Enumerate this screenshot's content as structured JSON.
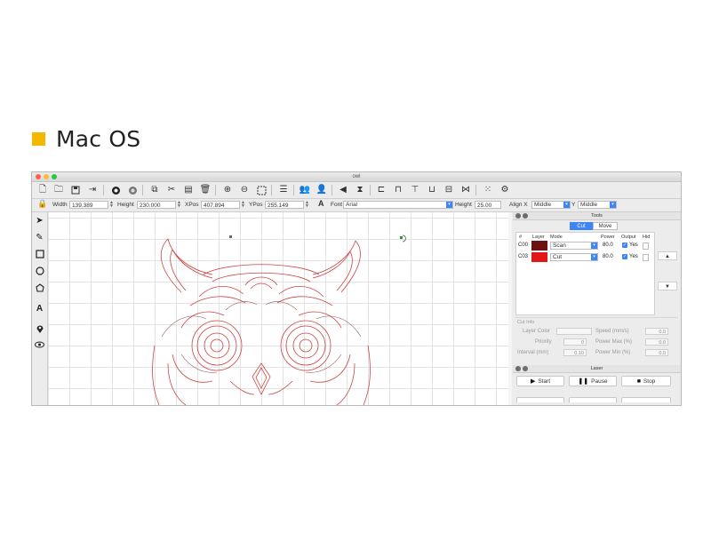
{
  "heading": {
    "title": "Mac OS",
    "bullet_color": "#f5b800"
  },
  "window": {
    "title": "owl",
    "traffic_lights": [
      "#ff5f57",
      "#febc2e",
      "#28c840"
    ],
    "toolbar_icons": [
      "new-file-icon",
      "open-folder-icon",
      "save-icon",
      "export-icon",
      "circle-filled-icon",
      "circle-gray-icon",
      "copy-icon",
      "cut-icon",
      "paste-icon",
      "delete-icon",
      "zoom-in-icon",
      "zoom-out-icon",
      "select-frame-icon",
      "list-icon",
      "group-icon",
      "user-icon",
      "flip-horizontal-icon",
      "mirror-icon",
      "align-left-icon",
      "align-top-icon",
      "align-center-icon",
      "align-bottom-icon",
      "distribute-icon",
      "link-icon",
      "grid-icon",
      "gear-icon"
    ],
    "properties": {
      "width_label": "Width",
      "width_value": "139.389",
      "height_label": "Height",
      "height_value": "230.000",
      "xpos_label": "XPos",
      "xpos_value": "407.894",
      "ypos_label": "YPos",
      "ypos_value": "255.149",
      "font_label": "Font",
      "font_value": "Arial",
      "text_height_label": "Height",
      "text_height_value": "25.00",
      "align_x_label": "Align X",
      "align_x_value": "Middle",
      "align_y_label": "Y",
      "align_y_value": "Middle"
    },
    "left_tools": [
      "pointer-icon",
      "pencil-icon",
      "rectangle-icon",
      "ellipse-icon",
      "polygon-icon",
      "text-icon",
      "position-pin-icon",
      "eye-icon"
    ],
    "tools_panel": {
      "title": "Tools",
      "tabs": [
        "Cut",
        "Move"
      ],
      "active_tab": "Cut",
      "columns": [
        "#",
        "Layer",
        "Mode",
        "Power",
        "Output",
        "Hid"
      ],
      "layers": [
        {
          "id": "C00",
          "color": "#6b1212",
          "mode": "Scan",
          "power": "80.0",
          "output": "Yes"
        },
        {
          "id": "C03",
          "color": "#e01818",
          "mode": "Cut",
          "power": "80.0",
          "output": "Yes"
        }
      ],
      "up_arrow": "▲",
      "down_arrow": "▼"
    },
    "cut_info": {
      "title": "Cut Info",
      "layer_color_label": "Layer Color",
      "speed_label": "Speed (mm/s)",
      "speed_value": "0.0",
      "priority_label": "Priority",
      "priority_value": "0",
      "power_max_label": "Power Max (%)",
      "power_max_value": "0.0",
      "interval_label": "Interval (mm)",
      "interval_value": "0.10",
      "power_min_label": "Power Min (%)",
      "power_min_value": "0.0"
    },
    "laser_panel": {
      "title": "Laser",
      "start_label": "Start",
      "pause_label": "Pause",
      "stop_label": "Stop"
    }
  }
}
